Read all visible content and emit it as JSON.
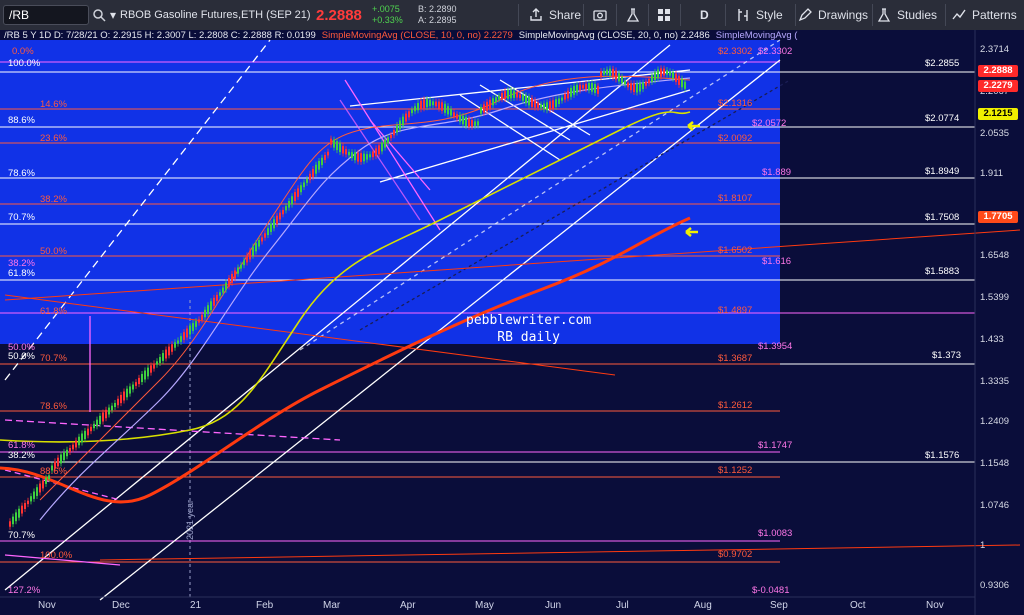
{
  "toolbar": {
    "symbol": "/RB",
    "instrument": "RBOB Gasoline Futures,ETH (SEP 21)",
    "last_price": "2.2888",
    "change": "+.0075",
    "change_pct": "+0.33%",
    "bid": "B: 2.2890",
    "ask": "A: 2.2895",
    "share_label": "Share",
    "interval_label": "D",
    "style_label": "Style",
    "drawings_label": "Drawings",
    "studies_label": "Studies",
    "patterns_label": "Patterns"
  },
  "legend": {
    "ohlc": "/RB 5 Y 1D   D: 7/28/21   O: 2.2915   H: 2.3007   L: 2.2808   C: 2.2888   R: 0.0199",
    "sma10": "SimpleMovingAvg (CLOSE, 10, 0, no)  2.2279",
    "sma20": "SimpleMovingAvg (CLOSE, 20, 0, no)  2.2486",
    "sma200": "SimpleMovingAvg ("
  },
  "left_fib_labels": [
    {
      "text": "0.0%",
      "color": "red"
    },
    {
      "text": "100.0%",
      "color": "white"
    },
    {
      "text": "14.6%",
      "color": "red"
    },
    {
      "text": "88.6%",
      "color": "white"
    },
    {
      "text": "23.6%",
      "color": "red"
    },
    {
      "text": "78.6%",
      "color": "white"
    },
    {
      "text": "38.2%",
      "color": "red"
    },
    {
      "text": "70.7%",
      "color": "white"
    },
    {
      "text": "50.0%",
      "color": "red"
    },
    {
      "text": "38.2%",
      "color": "pink"
    },
    {
      "text": "61.8%",
      "color": "white"
    },
    {
      "text": "61.8%",
      "color": "red"
    },
    {
      "text": "50.0%",
      "color": "pink"
    },
    {
      "text": "50.0%",
      "color": "white"
    },
    {
      "text": "70.7%",
      "color": "red"
    },
    {
      "text": "78.6%",
      "color": "red"
    },
    {
      "text": "61.8%",
      "color": "pink"
    },
    {
      "text": "38.2%",
      "color": "white"
    },
    {
      "text": "88.6%",
      "color": "red"
    },
    {
      "text": "70.7%",
      "color": "white"
    },
    {
      "text": "100.0%",
      "color": "red"
    },
    {
      "text": "127.2%",
      "color": "pink"
    }
  ],
  "right_level_labels": [
    {
      "text": "$2.3302",
      "color": "red"
    },
    {
      "text": "$2.3302",
      "color": "pink"
    },
    {
      "text": "$2.2855",
      "color": "white"
    },
    {
      "text": "$2.1316",
      "color": "red"
    },
    {
      "text": "$2.0572",
      "color": "pink"
    },
    {
      "text": "$2.0774",
      "color": "white"
    },
    {
      "text": "$2.0092",
      "color": "red"
    },
    {
      "text": "$1.889",
      "color": "pink"
    },
    {
      "text": "$1.8949",
      "color": "white"
    },
    {
      "text": "$1.8107",
      "color": "red"
    },
    {
      "text": "$1.7508",
      "color": "white"
    },
    {
      "text": "$1.6502",
      "color": "red"
    },
    {
      "text": "$1.616",
      "color": "pink"
    },
    {
      "text": "$1.5883",
      "color": "white"
    },
    {
      "text": "$1.4897",
      "color": "red"
    },
    {
      "text": "$1.3954",
      "color": "pink"
    },
    {
      "text": "$1.3687",
      "color": "red"
    },
    {
      "text": "$1.373",
      "color": "white"
    },
    {
      "text": "$1.2612",
      "color": "red"
    },
    {
      "text": "$1.1747",
      "color": "pink"
    },
    {
      "text": "$1.1576",
      "color": "white"
    },
    {
      "text": "$1.1252",
      "color": "red"
    },
    {
      "text": "$1.0083",
      "color": "pink"
    },
    {
      "text": "$0.9702",
      "color": "red"
    },
    {
      "text": "$-0.0481",
      "color": "pink"
    }
  ],
  "price_axis": [
    "2.3714",
    "2.2067",
    "2.0535",
    "1.911",
    "1.7783",
    "1.6548",
    "1.5399",
    "1.433",
    "1.3335",
    "1.2409",
    "1.1548",
    "1.0746",
    "1",
    "0.9306"
  ],
  "price_tags": [
    {
      "text": "2.2888",
      "color": "#ff2a2a",
      "fg": "#ffffff"
    },
    {
      "text": "2.2279",
      "color": "#ff2a2a",
      "fg": "#ffffff"
    },
    {
      "text": "2.1215",
      "color": "#f0f000",
      "fg": "#000000"
    },
    {
      "text": "1.7705",
      "color": "#ff4a1a",
      "fg": "#ffffff"
    }
  ],
  "months": [
    "Nov",
    "Dec",
    "21",
    "Feb",
    "Mar",
    "Apr",
    "May",
    "Jun",
    "Jul",
    "Aug",
    "Sep",
    "Oct",
    "Nov"
  ],
  "watermark": {
    "line1": "pebblewriter.com",
    "line2": "RB daily"
  },
  "year_marker": "2021 year",
  "colors": {
    "background": "#0a0d3a",
    "blue_zone": "#1238ff",
    "sma50": "#d8e000",
    "sma200": "#ff3a10",
    "price_up": "#3fd03f",
    "price_down": "#ff3333"
  }
}
